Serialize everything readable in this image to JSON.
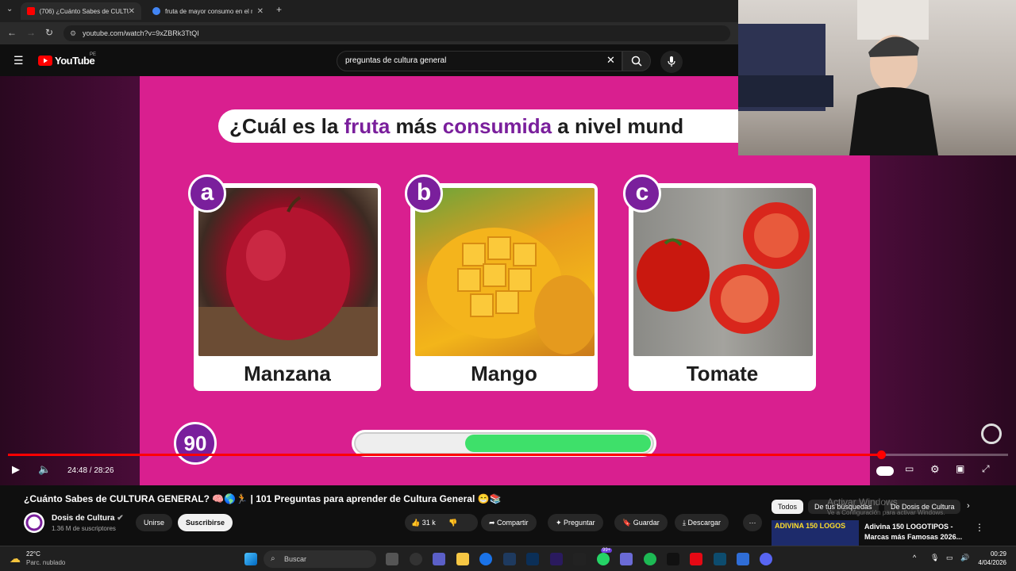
{
  "browser": {
    "tabs": [
      {
        "label": "(706) ¿Cuánto Sabes de CULTURA",
        "active": true
      },
      {
        "label": "fruta de mayor consumo en el m",
        "active": false
      }
    ],
    "new_tab": "+",
    "url": "youtube.com/watch?v=9xZBRk3TtQI"
  },
  "youtube": {
    "logo": "YouTube",
    "country": "PE",
    "search_value": "preguntas de cultura general"
  },
  "video": {
    "question_parts": [
      "¿Cuál es la ",
      "fruta",
      " más ",
      "consumida",
      " a nivel mund"
    ],
    "options": [
      {
        "letter": "a",
        "name": "Manzana"
      },
      {
        "letter": "b",
        "name": "Mango"
      },
      {
        "letter": "c",
        "name": "Tomate"
      }
    ],
    "timer": "90",
    "progress_fraction": 0.63,
    "played_fraction": 0.873,
    "time": "24:48 / 28:26"
  },
  "meta": {
    "title": "¿Cuánto Sabes de CULTURA GENERAL? 🧠🌎🏃 | 101 Preguntas para aprender de Cultura General 😁📚",
    "channel": "Dosis de Cultura",
    "subscribers": "1.36 M de suscriptores",
    "join": "Unirse",
    "subscribe": "Suscribirse",
    "likes": "31 k",
    "share": "Compartir",
    "ask": "Preguntar",
    "save": "Guardar",
    "download": "Descargar",
    "chips": [
      "Todos",
      "De tus búsquedas",
      "De Dosis de Cultura"
    ],
    "rec_title": "Adivina 150 LOGOTIPOS - Marcas más Famosas 2026...",
    "rec_thumb_text": "ADIVINA 150 LOGOS",
    "activate_windows": "Activar Windows",
    "activate_windows_sub": "Ve a Configuración para activar Windows."
  },
  "taskbar": {
    "temp": "22°C",
    "weather": "Parc. nublado",
    "search": "Buscar",
    "time": "00:29",
    "date": "4/04/2026",
    "badge": "99+"
  },
  "colors": {
    "accent": "#7a1f9c",
    "frame": "#d91f8f",
    "progress": "#3ee06a",
    "youtube_red": "#ff0000"
  }
}
